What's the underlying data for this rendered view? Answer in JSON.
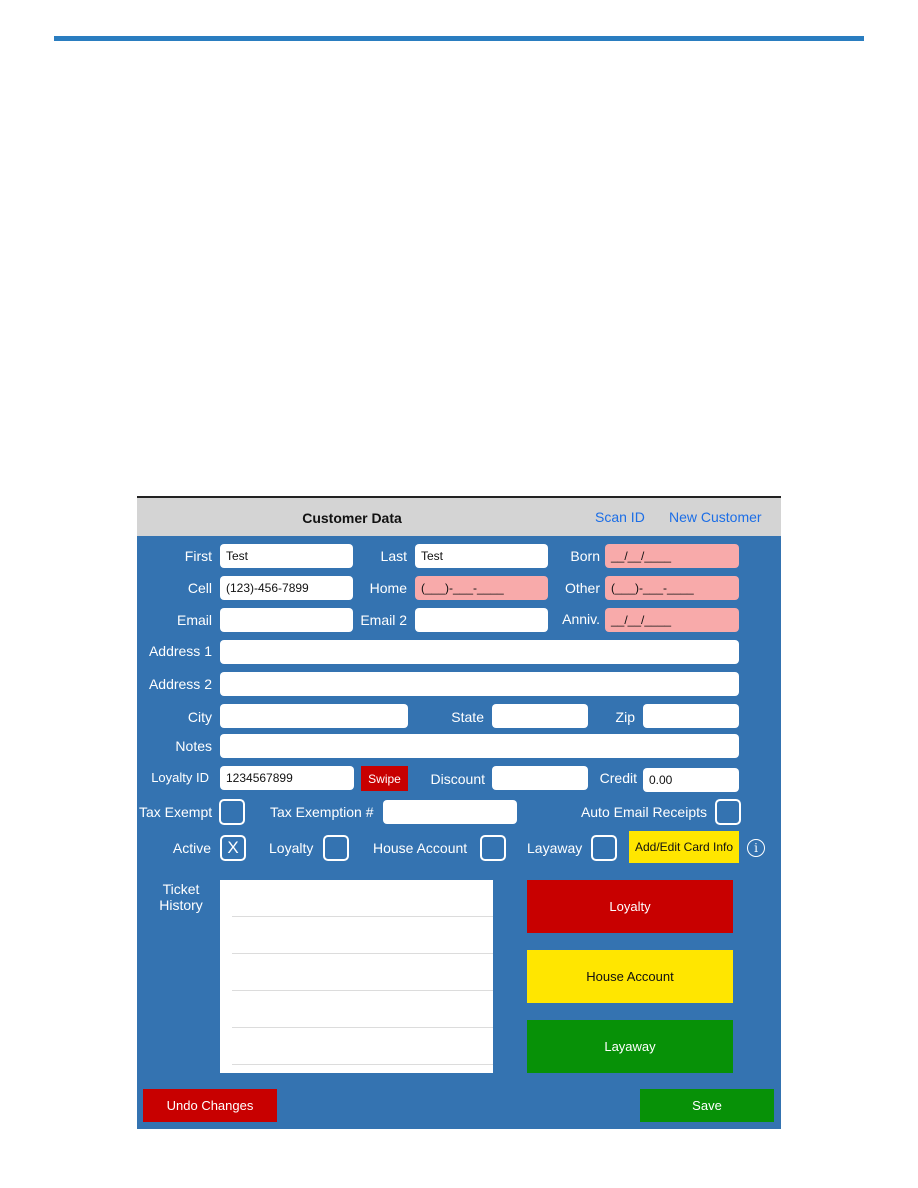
{
  "header": {
    "title": "Customer Data",
    "scan_id": "Scan ID",
    "new_customer": "New Customer"
  },
  "fields": {
    "first": {
      "label": "First",
      "value": "Test"
    },
    "last": {
      "label": "Last",
      "value": "Test"
    },
    "born": {
      "label": "Born",
      "value": "__/__/____"
    },
    "cell": {
      "label": "Cell",
      "value": "(123)-456-7899"
    },
    "home": {
      "label": "Home",
      "value": "(___)-___-____"
    },
    "other": {
      "label": "Other",
      "value": "(___)-___-____"
    },
    "email": {
      "label": "Email",
      "value": ""
    },
    "email2": {
      "label": "Email 2",
      "value": ""
    },
    "anniv": {
      "label": "Anniv.",
      "value": "__/__/____"
    },
    "address1": {
      "label": "Address 1",
      "value": ""
    },
    "address2": {
      "label": "Address 2",
      "value": ""
    },
    "city": {
      "label": "City",
      "value": ""
    },
    "state": {
      "label": "State",
      "value": ""
    },
    "zip": {
      "label": "Zip",
      "value": ""
    },
    "notes": {
      "label": "Notes",
      "value": ""
    },
    "loyalty_id": {
      "label": "Loyalty ID",
      "value": "1234567899"
    },
    "discount": {
      "label": "Discount",
      "value": ""
    },
    "credit": {
      "label": "Credit",
      "value": "0.00"
    },
    "tax_exemption_no": {
      "label": "Tax Exemption #",
      "value": ""
    }
  },
  "swipe_label": "Swipe",
  "checkboxes": {
    "tax_exempt": {
      "label": "Tax Exempt",
      "mark": ""
    },
    "auto_email": {
      "label": "Auto Email Receipts",
      "mark": ""
    },
    "active": {
      "label": "Active",
      "mark": "X"
    },
    "loyalty": {
      "label": "Loyalty",
      "mark": ""
    },
    "house_account": {
      "label": "House Account",
      "mark": ""
    },
    "layaway": {
      "label": "Layaway",
      "mark": ""
    }
  },
  "card_info_label": "Add/Edit Card Info",
  "info_glyph": "i",
  "ticket_history": {
    "label_line1": "Ticket",
    "label_line2": "History"
  },
  "actions": {
    "loyalty": "Loyalty",
    "house_account": "House Account",
    "layaway": "Layaway",
    "undo": "Undo Changes",
    "save": "Save"
  },
  "colors": {
    "panel": "#3473b1",
    "red": "#c80000",
    "yellow": "#ffe600",
    "green": "#079107",
    "link": "#1c6ee6",
    "date_phone_field": "#f8aaaa"
  }
}
